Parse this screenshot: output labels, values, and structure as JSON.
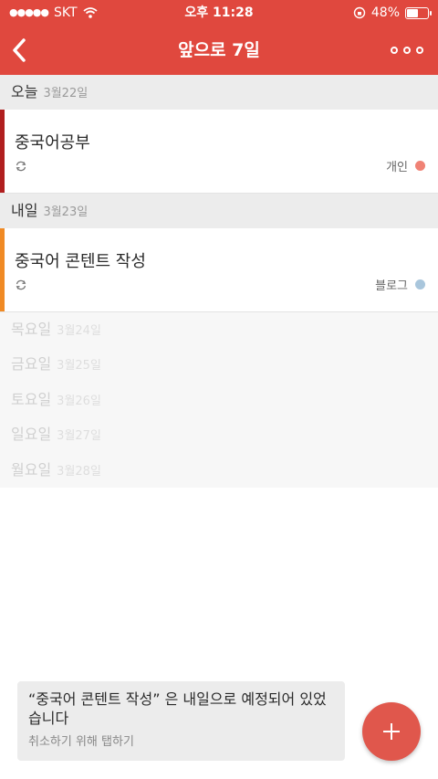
{
  "status": {
    "carrier": "SKT",
    "time": "오후 11:28",
    "battery": "48%",
    "battery_level": 0.48
  },
  "nav": {
    "title": "앞으로 7일",
    "back_icon": "chevron-left-icon",
    "more_icon": "more-horizontal-icon"
  },
  "today": {
    "label": "오늘",
    "date": "3월22일",
    "tasks": [
      {
        "title": "중국어공부",
        "category": "개인",
        "bar_color": "#b01e1e",
        "dot_color": "#f08275"
      }
    ]
  },
  "tomorrow": {
    "label": "내일",
    "date": "3월23일",
    "tasks": [
      {
        "title": "중국어 콘텐트 작성",
        "category": "블로그",
        "bar_color": "#f08a24",
        "dot_color": "#a9c6dc"
      }
    ]
  },
  "future_days": [
    {
      "name": "목요일",
      "date": "3월24일"
    },
    {
      "name": "금요일",
      "date": "3월25일"
    },
    {
      "name": "토요일",
      "date": "3월26일"
    },
    {
      "name": "일요일",
      "date": "3월27일"
    },
    {
      "name": "월요일",
      "date": "3월28일"
    }
  ],
  "toast": {
    "message": "“중국어 콘텐트 작성” 은 내일으로 예정되어 있었습니다",
    "action": "취소하기 위해 탭하기"
  },
  "fab": {
    "icon": "plus-icon"
  },
  "colors": {
    "accent": "#e0483e",
    "fab": "#e0574c"
  }
}
